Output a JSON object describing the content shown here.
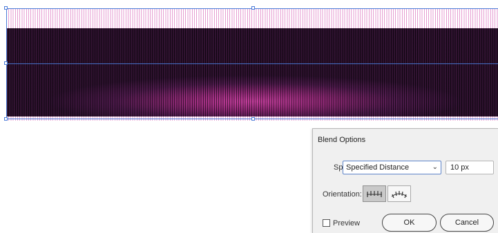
{
  "dialog": {
    "title": "Blend Options",
    "spacing": {
      "label": "Spacing:",
      "selected": "Specified Distance",
      "value": "10 px"
    },
    "orientation": {
      "label": "Orientation:",
      "options": [
        "align-to-page-icon",
        "align-to-path-icon"
      ],
      "active_index": 0
    },
    "preview_label": "Preview",
    "preview_checked": false,
    "ok_label": "OK",
    "cancel_label": "Cancel"
  },
  "colors": {
    "selection": "#4a7bd8",
    "stripe_light": "#e59bd0",
    "band_dark": "#1e0a22",
    "band_glow": "#c23b9a"
  }
}
